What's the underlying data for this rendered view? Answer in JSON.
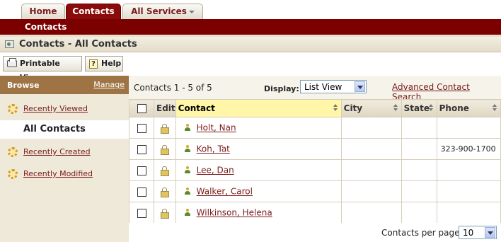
{
  "tabs": {
    "home": "Home",
    "contacts": "Contacts",
    "all_services": "All Services"
  },
  "subnav": {
    "contacts": "Contacts"
  },
  "page_title": "Contacts - All Contacts",
  "toolbar": {
    "printable_view": "Printable View",
    "help": "Help",
    "help_glyph": "?"
  },
  "sidebar": {
    "browse": "Browse",
    "manage": "Manage",
    "items": [
      {
        "label": "Recently Viewed",
        "icon": "gear-icon"
      },
      {
        "label": "All Contacts",
        "icon": "none",
        "active": true
      },
      {
        "label": "Recently Created",
        "icon": "gear-icon"
      },
      {
        "label": "Recently Modified",
        "icon": "gear-icon"
      }
    ]
  },
  "list": {
    "count_text": "Contacts 1 - 5 of 5",
    "display_label": "Display:",
    "display_value": "List View",
    "advanced_search": "Advanced Contact Search",
    "columns": {
      "edit": "Edit",
      "contact": "Contact",
      "city": "City",
      "state": "State",
      "phone": "Phone"
    },
    "rows": [
      {
        "name": "Holt, Nan",
        "city": "",
        "state": "",
        "phone": ""
      },
      {
        "name": "Koh, Tat",
        "city": "",
        "state": "",
        "phone": "323-900-1700"
      },
      {
        "name": "Lee, Dan",
        "city": "",
        "state": "",
        "phone": ""
      },
      {
        "name": "Walker, Carol",
        "city": "",
        "state": "",
        "phone": ""
      },
      {
        "name": "Wilkinson, Helena",
        "city": "",
        "state": "",
        "phone": ""
      }
    ],
    "per_page_label": "Contacts per page",
    "per_page_value": "10"
  },
  "colors": {
    "brand": "#7b0000",
    "link": "#7a1c1c",
    "sidebar_header": "#9e7444",
    "highlight": "#fff6a8"
  }
}
